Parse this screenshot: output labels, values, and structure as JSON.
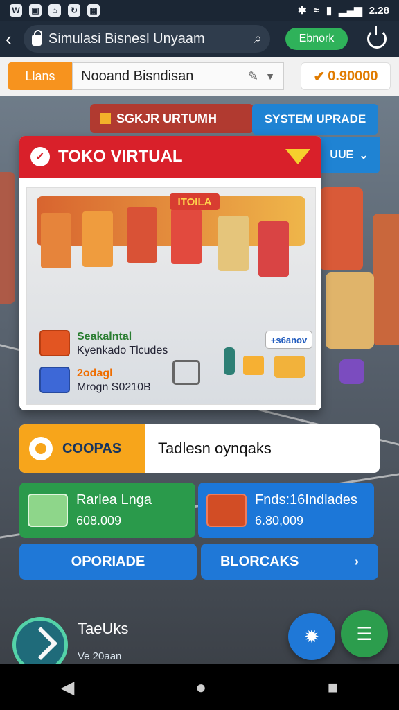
{
  "statusbar": {
    "left_icons": [
      "whatsapp-icon",
      "image-icon",
      "chat-icon",
      "sync-icon",
      "grid-icon"
    ],
    "time": "2.28"
  },
  "urlbar": {
    "title": "Simulasi Bisnesl Unyaam",
    "search_icon": "search-icon",
    "pill_label": "Ebnork",
    "power_icon": "power-icon"
  },
  "toolbar": {
    "tab_label": "Llans",
    "select_value": "Nooand Bisndisan",
    "price": "0.90000"
  },
  "store": {
    "banner_label": "SGKJR URTUMH",
    "system_button": "SYSTEM UPRADE",
    "side_button": "UUE",
    "card_title": "TOKO VIRTUAL",
    "store_sign": "ITOILA",
    "info_head_1": "Seakalntal",
    "info_sub_1": "Kyenkado Tlcudes",
    "info_head_2": "2odagl",
    "info_sub_2": "Mrogn S0210B",
    "promo_label": "+s6anov"
  },
  "widebar": {
    "left_label": "COOPAS",
    "right_text": "Tadlesn oynqaks"
  },
  "stats": {
    "left_title": "Rarlea Lnga",
    "left_value": "608.009",
    "right_title": "Fnds:16Indlades",
    "right_value": "6.80,009"
  },
  "actions": {
    "left_button": "OPORIADE",
    "right_button": "BLORCAKS"
  },
  "bottom": {
    "title": "TaeUks",
    "subtitle": "Ve 20aan"
  },
  "colors": {
    "accent_orange": "#f7931e",
    "accent_red": "#d9202a",
    "accent_blue": "#1f83d3",
    "accent_green": "#2fb25a"
  }
}
